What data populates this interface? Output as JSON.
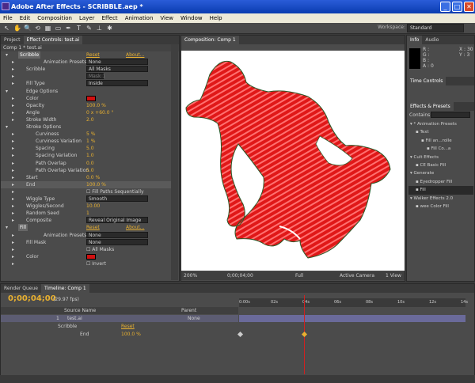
{
  "window": {
    "title": "Adobe After Effects - SCRIBBLE.aep *",
    "minimize": "_",
    "maximize": "□",
    "close": "✕"
  },
  "menu": [
    "File",
    "Edit",
    "Composition",
    "Layer",
    "Effect",
    "Animation",
    "View",
    "Window",
    "Help"
  ],
  "toolbar": {
    "workspace_label": "Workspace:",
    "workspace_value": "Standard",
    "tools": [
      "↖",
      "✋",
      "🔍",
      "⟲",
      "▦",
      "▭",
      "✒",
      "T",
      "✎",
      "⊥",
      "✱"
    ]
  },
  "left_panel": {
    "tabs": [
      "Project",
      "Effect Controls: test.ai"
    ],
    "breadcrumb": "Comp 1 * test.ai",
    "rows": [
      {
        "label": "Scribble",
        "value": "Reset",
        "extra": "About...",
        "kind": "effect"
      },
      {
        "label": "Animation Presets:",
        "value": "None",
        "kind": "preset"
      },
      {
        "label": "Scribble",
        "value": "All Masks",
        "kind": "select"
      },
      {
        "label": "",
        "value": "Mask 1",
        "kind": "disabled"
      },
      {
        "label": "Fill Type",
        "value": "Inside",
        "kind": "select"
      },
      {
        "label": "Edge Options",
        "kind": "group"
      },
      {
        "label": "Color",
        "kind": "color"
      },
      {
        "label": "Opacity",
        "value": "100.0 %"
      },
      {
        "label": "Angle",
        "value": "0 x +60.0 °"
      },
      {
        "label": "Stroke Width",
        "value": "2.0"
      },
      {
        "label": "Stroke Options",
        "kind": "group"
      },
      {
        "label": "Curviness",
        "value": "5 %",
        "indent": 1
      },
      {
        "label": "Curviness Variation",
        "value": "1 %",
        "indent": 1
      },
      {
        "label": "Spacing",
        "value": "5.0",
        "indent": 1
      },
      {
        "label": "Spacing Variation",
        "value": "1.0",
        "indent": 1
      },
      {
        "label": "Path Overlap",
        "value": "0.0",
        "indent": 1
      },
      {
        "label": "Path Overlap Variation",
        "value": "5.0",
        "indent": 1
      },
      {
        "label": "Start",
        "value": "0.0 %"
      },
      {
        "label": "End",
        "value": "100.0 %",
        "kind": "hl"
      },
      {
        "label": "",
        "value": "Fill Paths Sequentially",
        "kind": "check"
      },
      {
        "label": "Wiggle Type",
        "value": "Smooth",
        "kind": "select"
      },
      {
        "label": "Wiggles/Second",
        "value": "10.00"
      },
      {
        "label": "Random Seed",
        "value": "1"
      },
      {
        "label": "Composite",
        "value": "Reveal Original Image",
        "kind": "select"
      },
      {
        "label": "Fill",
        "value": "Reset",
        "extra": "About...",
        "kind": "effect"
      },
      {
        "label": "Animation Presets:",
        "value": "None",
        "kind": "preset"
      },
      {
        "label": "Fill Mask",
        "value": "None",
        "kind": "select"
      },
      {
        "label": "",
        "value": "All Masks",
        "kind": "check"
      },
      {
        "label": "Color",
        "kind": "color"
      },
      {
        "label": "",
        "value": "Invert",
        "kind": "check"
      }
    ]
  },
  "comp": {
    "tab": "Composition: Comp 1",
    "zoom": "200%",
    "timecode": "0;00;04;00",
    "resolution": "Full",
    "camera": "Active Camera",
    "views": "1 View",
    "scribble_color": "#e01818"
  },
  "right": {
    "info_tabs": [
      "Info",
      "Audio"
    ],
    "info": [
      "R :",
      "G :",
      "B :",
      "A : 0"
    ],
    "coords": [
      "X : 30",
      "Y : 3"
    ],
    "time_controls": "Time Controls",
    "effects_tab": "Effects & Presets",
    "contains_label": "Contains:",
    "tree": [
      {
        "label": "* Animation Presets",
        "level": 0
      },
      {
        "label": "Text",
        "level": 1
      },
      {
        "label": "Fill an...rolle",
        "level": 2
      },
      {
        "label": "Fill Co...a",
        "level": 3
      },
      {
        "label": "Cult Effects",
        "level": 0
      },
      {
        "label": "CE Basic Fill",
        "level": 1
      },
      {
        "label": "Generate",
        "level": 0
      },
      {
        "label": "Eyedropper Fill",
        "level": 1
      },
      {
        "label": "Fill",
        "level": 1
      },
      {
        "label": "Walker Effects 2.0",
        "level": 0
      },
      {
        "label": "wee Color Fill",
        "level": 1
      }
    ]
  },
  "timeline": {
    "tabs": [
      "Render Queue",
      "Timeline: Comp 1"
    ],
    "timecode": "0;00;04;00",
    "fps": "(29.97 fps)",
    "col_source": "Source Name",
    "col_parent": "Parent",
    "ruler": [
      "0:00s",
      "02s",
      "04s",
      "06s",
      "08s",
      "10s",
      "12s",
      "14s"
    ],
    "layer_num": "1",
    "layer_name": "test.ai",
    "parent_value": "None",
    "effect_name": "Scribble",
    "effect_reset": "Reset",
    "prop_name": "End",
    "prop_value": "100.0 %"
  }
}
